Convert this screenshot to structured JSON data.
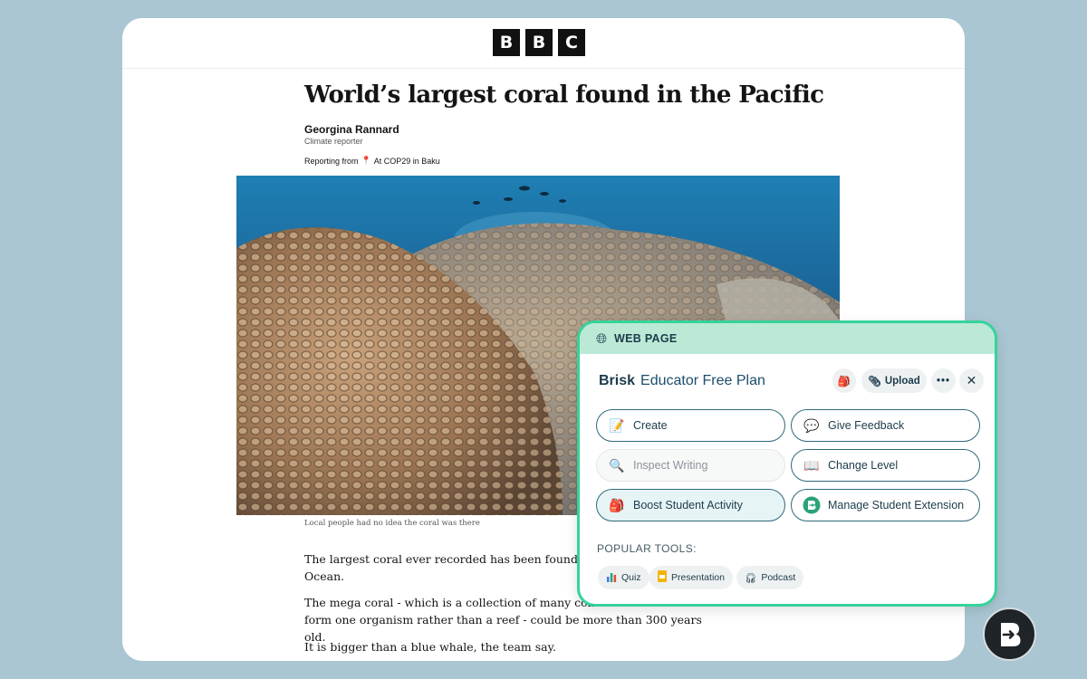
{
  "article": {
    "logo_letters": [
      "B",
      "B",
      "C"
    ],
    "headline": "World’s largest coral found in the Pacific",
    "author": "Georgina Rannard",
    "role": "Climate reporter",
    "reporting_prefix": "Reporting from",
    "reporting_location": "At COP29 in Baku",
    "caption": "Local people had no idea the coral was there",
    "paragraphs": [
      "The largest coral ever recorded has been found by s",
      "Ocean.",
      "The mega coral - which is a collection of many connec",
      "form one organism rather than a reef - could be more than 300 years old.",
      "It is bigger than a blue whale, the team say."
    ]
  },
  "brisk": {
    "context_label": "WEB PAGE",
    "brand": "Brisk",
    "plan": "Educator Free Plan",
    "upload_label": "Upload",
    "tools": [
      {
        "label": "Create",
        "icon": "memo-icon"
      },
      {
        "label": "Give Feedback",
        "icon": "speech-bubble-icon"
      },
      {
        "label": "Inspect Writing",
        "icon": "magnifier-icon",
        "disabled": true
      },
      {
        "label": "Change Level",
        "icon": "open-book-icon"
      },
      {
        "label": "Boost Student Activity",
        "icon": "backpack-icon",
        "active": true
      },
      {
        "label": "Manage Student Extension",
        "icon": "brisk-extension-icon"
      }
    ],
    "popular_label": "POPULAR TOOLS:",
    "popular_tools": [
      {
        "label": "Quiz",
        "icon": "bar-chart-icon"
      },
      {
        "label": "Presentation",
        "icon": "slides-icon"
      },
      {
        "label": "Podcast",
        "icon": "headphones-icon"
      }
    ]
  },
  "colors": {
    "page_bg": "#a9c6d2",
    "brisk_border": "#35d39a",
    "brisk_header_bg": "#bce9d6",
    "brisk_text": "#1c3b4a"
  }
}
